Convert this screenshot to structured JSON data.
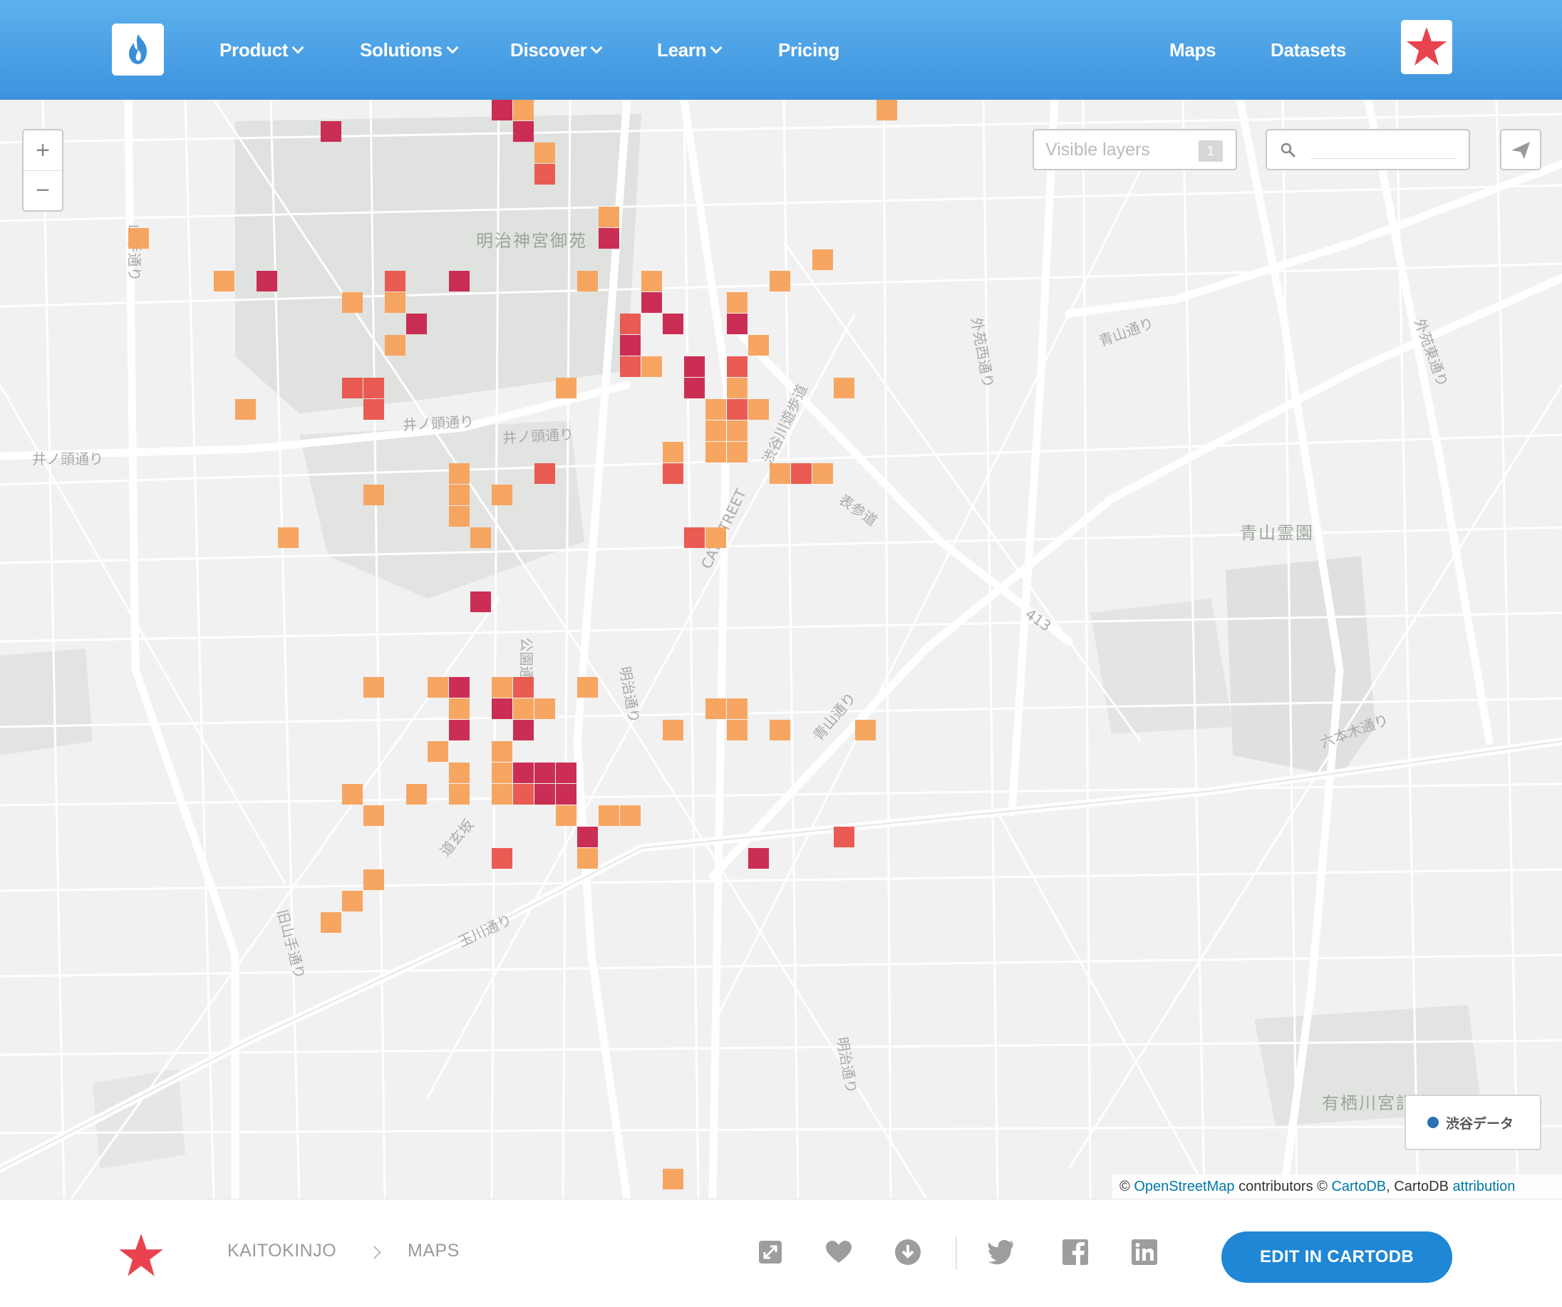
{
  "header": {
    "nav": [
      {
        "label": "Product",
        "dropdown": true
      },
      {
        "label": "Solutions",
        "dropdown": true
      },
      {
        "label": "Discover",
        "dropdown": true
      },
      {
        "label": "Learn",
        "dropdown": true
      },
      {
        "label": "Pricing",
        "dropdown": false
      }
    ],
    "right_links": [
      "Maps",
      "Datasets"
    ]
  },
  "map": {
    "controls": {
      "zoom_in": "+",
      "zoom_out": "−",
      "visible_layers_label": "Visible layers",
      "visible_layers_count": "1",
      "search_value": ""
    },
    "labels": [
      {
        "text": "明治神宮御苑",
        "kind": "park"
      },
      {
        "text": "青山霊園",
        "kind": "park"
      },
      {
        "text": "有栖川宮記念公園",
        "kind": "park"
      },
      {
        "text": "井ノ頭通り",
        "kind": "street"
      },
      {
        "text": "井ノ頭通り",
        "kind": "street"
      },
      {
        "text": "井ノ頭通り",
        "kind": "street"
      },
      {
        "text": "山手通り",
        "kind": "street"
      },
      {
        "text": "青山通り",
        "kind": "street"
      },
      {
        "text": "青山通り",
        "kind": "street"
      },
      {
        "text": "明治通り",
        "kind": "street"
      },
      {
        "text": "明治通り",
        "kind": "street"
      },
      {
        "text": "玉川通り",
        "kind": "street"
      },
      {
        "text": "外苑西通り",
        "kind": "street"
      },
      {
        "text": "外苑東通り",
        "kind": "street"
      },
      {
        "text": "表参道",
        "kind": "street"
      },
      {
        "text": "渋谷川遊歩道",
        "kind": "street"
      },
      {
        "text": "CAT STREET",
        "kind": "street"
      },
      {
        "text": "413",
        "kind": "route"
      },
      {
        "text": "公園通り",
        "kind": "street"
      },
      {
        "text": "道玄坂",
        "kind": "street"
      },
      {
        "text": "旧山手通り",
        "kind": "street"
      },
      {
        "text": "六本木通り",
        "kind": "street"
      }
    ],
    "grid_cells": [
      {
        "row": 0,
        "col": 23,
        "level": 3
      },
      {
        "row": 0,
        "col": 24,
        "level": 1
      },
      {
        "row": 0,
        "col": 41,
        "level": 1
      },
      {
        "row": 1,
        "col": 15,
        "level": 3
      },
      {
        "row": 1,
        "col": 24,
        "level": 3
      },
      {
        "row": 2,
        "col": 25,
        "level": 1
      },
      {
        "row": 3,
        "col": 25,
        "level": 2
      },
      {
        "row": 5,
        "col": 28,
        "level": 1
      },
      {
        "row": 6,
        "col": 6,
        "level": 1
      },
      {
        "row": 6,
        "col": 28,
        "level": 3
      },
      {
        "row": 7,
        "col": 38,
        "level": 1
      },
      {
        "row": 8,
        "col": 10,
        "level": 1
      },
      {
        "row": 8,
        "col": 12,
        "level": 3
      },
      {
        "row": 8,
        "col": 18,
        "level": 2
      },
      {
        "row": 8,
        "col": 21,
        "level": 3
      },
      {
        "row": 8,
        "col": 27,
        "level": 1
      },
      {
        "row": 8,
        "col": 30,
        "level": 1
      },
      {
        "row": 8,
        "col": 36,
        "level": 1
      },
      {
        "row": 9,
        "col": 16,
        "level": 1
      },
      {
        "row": 9,
        "col": 18,
        "level": 1
      },
      {
        "row": 9,
        "col": 30,
        "level": 3
      },
      {
        "row": 9,
        "col": 34,
        "level": 1
      },
      {
        "row": 10,
        "col": 19,
        "level": 3
      },
      {
        "row": 10,
        "col": 29,
        "level": 2
      },
      {
        "row": 10,
        "col": 31,
        "level": 3
      },
      {
        "row": 10,
        "col": 34,
        "level": 3
      },
      {
        "row": 11,
        "col": 18,
        "level": 1
      },
      {
        "row": 11,
        "col": 29,
        "level": 3
      },
      {
        "row": 11,
        "col": 35,
        "level": 1
      },
      {
        "row": 12,
        "col": 29,
        "level": 2
      },
      {
        "row": 12,
        "col": 30,
        "level": 1
      },
      {
        "row": 12,
        "col": 32,
        "level": 3
      },
      {
        "row": 12,
        "col": 34,
        "level": 2
      },
      {
        "row": 13,
        "col": 16,
        "level": 2
      },
      {
        "row": 13,
        "col": 17,
        "level": 2
      },
      {
        "row": 13,
        "col": 26,
        "level": 1
      },
      {
        "row": 13,
        "col": 32,
        "level": 3
      },
      {
        "row": 13,
        "col": 34,
        "level": 1
      },
      {
        "row": 13,
        "col": 39,
        "level": 1
      },
      {
        "row": 14,
        "col": 11,
        "level": 1
      },
      {
        "row": 14,
        "col": 17,
        "level": 2
      },
      {
        "row": 14,
        "col": 33,
        "level": 1
      },
      {
        "row": 14,
        "col": 34,
        "level": 2
      },
      {
        "row": 14,
        "col": 35,
        "level": 1
      },
      {
        "row": 15,
        "col": 33,
        "level": 1
      },
      {
        "row": 15,
        "col": 34,
        "level": 1
      },
      {
        "row": 16,
        "col": 31,
        "level": 1
      },
      {
        "row": 16,
        "col": 33,
        "level": 1
      },
      {
        "row": 16,
        "col": 34,
        "level": 1
      },
      {
        "row": 17,
        "col": 21,
        "level": 1
      },
      {
        "row": 17,
        "col": 25,
        "level": 2
      },
      {
        "row": 17,
        "col": 31,
        "level": 2
      },
      {
        "row": 17,
        "col": 36,
        "level": 1
      },
      {
        "row": 17,
        "col": 37,
        "level": 2
      },
      {
        "row": 17,
        "col": 38,
        "level": 1
      },
      {
        "row": 18,
        "col": 17,
        "level": 1
      },
      {
        "row": 18,
        "col": 21,
        "level": 1
      },
      {
        "row": 18,
        "col": 23,
        "level": 1
      },
      {
        "row": 19,
        "col": 21,
        "level": 1
      },
      {
        "row": 20,
        "col": 13,
        "level": 1
      },
      {
        "row": 20,
        "col": 22,
        "level": 1
      },
      {
        "row": 20,
        "col": 32,
        "level": 2
      },
      {
        "row": 20,
        "col": 33,
        "level": 1
      },
      {
        "row": 23,
        "col": 22,
        "level": 3
      },
      {
        "row": 27,
        "col": 17,
        "level": 1
      },
      {
        "row": 27,
        "col": 20,
        "level": 1
      },
      {
        "row": 27,
        "col": 21,
        "level": 3
      },
      {
        "row": 27,
        "col": 23,
        "level": 1
      },
      {
        "row": 27,
        "col": 24,
        "level": 2
      },
      {
        "row": 27,
        "col": 27,
        "level": 1
      },
      {
        "row": 28,
        "col": 21,
        "level": 1
      },
      {
        "row": 28,
        "col": 23,
        "level": 3
      },
      {
        "row": 28,
        "col": 24,
        "level": 1
      },
      {
        "row": 28,
        "col": 25,
        "level": 1
      },
      {
        "row": 28,
        "col": 33,
        "level": 1
      },
      {
        "row": 28,
        "col": 34,
        "level": 1
      },
      {
        "row": 29,
        "col": 21,
        "level": 3
      },
      {
        "row": 29,
        "col": 24,
        "level": 3
      },
      {
        "row": 29,
        "col": 31,
        "level": 1
      },
      {
        "row": 29,
        "col": 34,
        "level": 1
      },
      {
        "row": 29,
        "col": 36,
        "level": 1
      },
      {
        "row": 29,
        "col": 40,
        "level": 1
      },
      {
        "row": 30,
        "col": 20,
        "level": 1
      },
      {
        "row": 30,
        "col": 23,
        "level": 1
      },
      {
        "row": 31,
        "col": 21,
        "level": 1
      },
      {
        "row": 31,
        "col": 23,
        "level": 1
      },
      {
        "row": 31,
        "col": 24,
        "level": 3
      },
      {
        "row": 31,
        "col": 25,
        "level": 3
      },
      {
        "row": 31,
        "col": 26,
        "level": 3
      },
      {
        "row": 32,
        "col": 16,
        "level": 1
      },
      {
        "row": 32,
        "col": 19,
        "level": 1
      },
      {
        "row": 32,
        "col": 21,
        "level": 1
      },
      {
        "row": 32,
        "col": 23,
        "level": 1
      },
      {
        "row": 32,
        "col": 24,
        "level": 2
      },
      {
        "row": 32,
        "col": 25,
        "level": 3
      },
      {
        "row": 32,
        "col": 26,
        "level": 3
      },
      {
        "row": 33,
        "col": 17,
        "level": 1
      },
      {
        "row": 33,
        "col": 26,
        "level": 1
      },
      {
        "row": 33,
        "col": 28,
        "level": 1
      },
      {
        "row": 33,
        "col": 29,
        "level": 1
      },
      {
        "row": 34,
        "col": 27,
        "level": 3
      },
      {
        "row": 34,
        "col": 39,
        "level": 2
      },
      {
        "row": 35,
        "col": 23,
        "level": 2
      },
      {
        "row": 35,
        "col": 27,
        "level": 1
      },
      {
        "row": 35,
        "col": 35,
        "level": 3
      },
      {
        "row": 36,
        "col": 17,
        "level": 1
      },
      {
        "row": 37,
        "col": 16,
        "level": 1
      },
      {
        "row": 38,
        "col": 15,
        "level": 1
      },
      {
        "row": 50,
        "col": 31,
        "level": 1
      }
    ],
    "level_colors": {
      "1": "#f7a15a",
      "2": "#e9524a",
      "3": "#c8234b"
    },
    "legend": {
      "label": "渋谷データ",
      "color": "#2c6fb5"
    },
    "attribution": {
      "prefix": "©",
      "osm": "OpenStreetMap",
      "mid": "contributors ©",
      "carto": "CartoDB",
      "mid2": ", CartoDB",
      "attr": "attribution"
    }
  },
  "footer": {
    "breadcrumb": [
      "KAITOKINJO",
      "MAPS"
    ],
    "edit_button": "EDIT IN CARTODB",
    "icons": [
      "fullscreen-icon",
      "heart-icon",
      "download-icon",
      "twitter-icon",
      "facebook-icon",
      "linkedin-icon"
    ]
  },
  "colors": {
    "header_top": "#5db1ee",
    "header_bottom": "#3c93dd",
    "accent_star": "#e8434f",
    "button": "#1f87d5"
  }
}
